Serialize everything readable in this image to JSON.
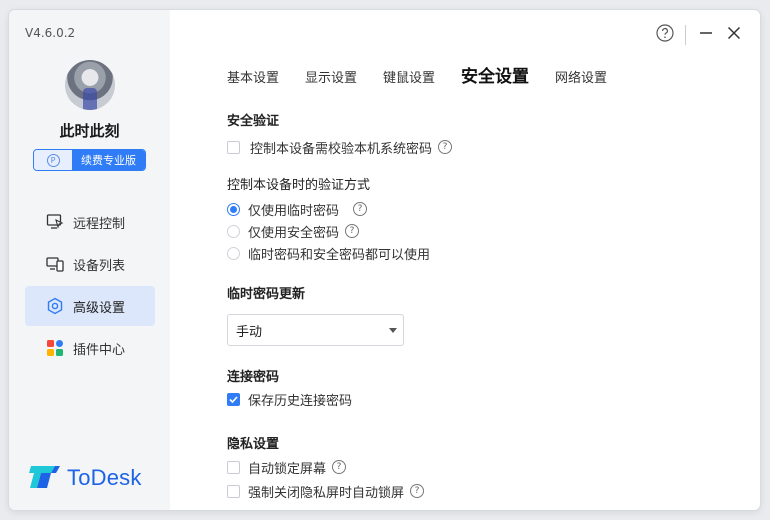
{
  "app": {
    "version": "V4.6.0.2",
    "username": "此时此刻",
    "badge_label": "续费专业版",
    "badge_icon": "P",
    "logo_text": "ToDesk",
    "brand_color": "#1c63e6",
    "accent_color": "#2f7cf6"
  },
  "sidebar": {
    "items": [
      {
        "label": "远程控制",
        "icon": "remote-control-icon",
        "active": false
      },
      {
        "label": "设备列表",
        "icon": "device-list-icon",
        "active": false
      },
      {
        "label": "高级设置",
        "icon": "advanced-settings-icon",
        "active": true
      },
      {
        "label": "插件中心",
        "icon": "plugin-center-icon",
        "active": false
      }
    ]
  },
  "tabs": [
    {
      "label": "基本设置",
      "active": false
    },
    {
      "label": "显示设置",
      "active": false
    },
    {
      "label": "键鼠设置",
      "active": false
    },
    {
      "label": "安全设置",
      "active": true
    },
    {
      "label": "网络设置",
      "active": false
    }
  ],
  "security": {
    "auth_title": "安全验证",
    "auth_checkbox_label": "控制本设备需校验本机系统密码",
    "auth_checked": false,
    "verify_title": "控制本设备时的验证方式",
    "verify_options": [
      {
        "label": "仅使用临时密码",
        "checked": true,
        "help": true
      },
      {
        "label": "仅使用安全密码",
        "checked": false,
        "help": true
      },
      {
        "label": "临时密码和安全密码都可以使用",
        "checked": false,
        "help": false
      }
    ],
    "temp_title": "临时密码更新",
    "temp_value": "手动",
    "conn_title": "连接密码",
    "conn_checkbox_label": "保存历史连接密码",
    "conn_checked": true,
    "privacy_title": "隐私设置",
    "privacy_options": [
      {
        "label": "自动锁定屏幕",
        "checked": false
      },
      {
        "label": "强制关闭隐私屏时自动锁屏",
        "checked": false
      }
    ]
  },
  "help_glyph": "?"
}
